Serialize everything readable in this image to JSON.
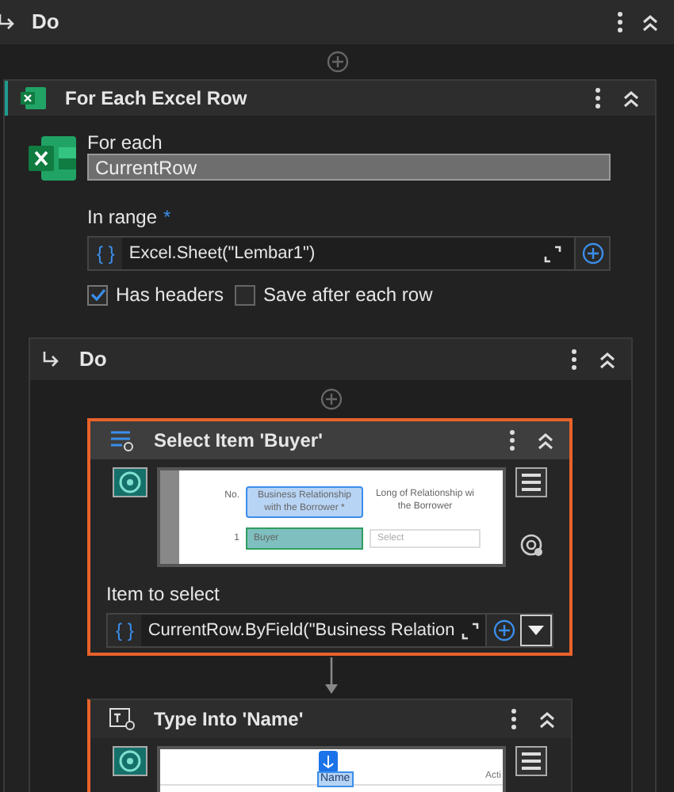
{
  "outer_scope": {
    "title": "Do"
  },
  "for_each_card": {
    "title": "For Each Excel Row",
    "for_each_label": "For each",
    "for_each_value": "CurrentRow",
    "range_label": "In range",
    "range_required_mark": "*",
    "expression_mark": "{ }",
    "range_value": "Excel.Sheet(\"Lembar1\")",
    "options": [
      {
        "label": "Has headers",
        "checked": true
      },
      {
        "label": "Save after each row",
        "checked": false
      }
    ]
  },
  "inner_scope": {
    "title": "Do"
  },
  "activities": [
    {
      "kind": "select_item",
      "title": "Select Item 'Buyer'",
      "selected": true,
      "preview": {
        "headers": [
          "No.",
          "Business Relationship with the Borrower *",
          "Long of Relationship wi the Borrower"
        ],
        "row_number": "1",
        "cell_value": "Buyer",
        "cell_placeholder": "Select"
      },
      "field_label": "Item to select",
      "expression_mark": "{ }",
      "field_value": "CurrentRow.ByField(\"Business Relation"
    },
    {
      "kind": "type_into",
      "title": "Type Into 'Name'",
      "selected": false,
      "preview": {
        "tag": "Name",
        "column": "Acti"
      }
    }
  ]
}
